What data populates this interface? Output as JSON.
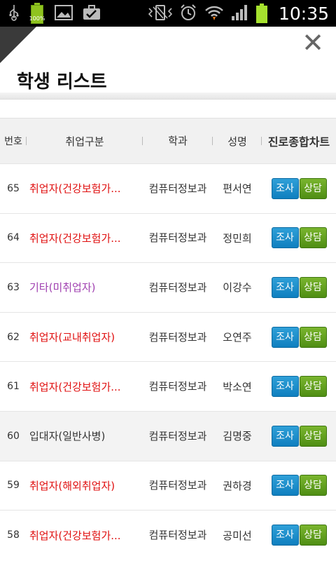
{
  "status_bar": {
    "time": "10:35",
    "battery_left_label": "100%",
    "icons": [
      "usb-icon",
      "battery-icon",
      "image-icon",
      "briefcase-icon",
      "vibrate-icon",
      "alarm-icon",
      "wifi-icon",
      "signal-icon",
      "battery-icon"
    ]
  },
  "header": {
    "title": "학생 리스트",
    "close_label": "✕"
  },
  "table": {
    "columns": [
      "번호",
      "취업구분",
      "학과",
      "성명",
      "진로종합차트"
    ],
    "survey_label": "조사",
    "consult_label": "상담",
    "rows": [
      {
        "num": "65",
        "type": "취업자(건강보험가...",
        "type_color": "red",
        "dept": "컴퓨터정보과",
        "name": "편서연"
      },
      {
        "num": "64",
        "type": "취업자(건강보험가...",
        "type_color": "red",
        "dept": "컴퓨터정보과",
        "name": "정민희"
      },
      {
        "num": "63",
        "type": "기타(미취업자)",
        "type_color": "purple",
        "dept": "컴퓨터정보과",
        "name": "이강수"
      },
      {
        "num": "62",
        "type": "취업자(교내취업자)",
        "type_color": "red",
        "dept": "컴퓨터정보과",
        "name": "오연주"
      },
      {
        "num": "61",
        "type": "취업자(건강보험가...",
        "type_color": "red",
        "dept": "컴퓨터정보과",
        "name": "박소연"
      },
      {
        "num": "60",
        "type": "입대자(일반사병)",
        "type_color": "gray",
        "dept": "컴퓨터정보과",
        "name": "김명중"
      },
      {
        "num": "59",
        "type": "취업자(해외취업자)",
        "type_color": "red",
        "dept": "컴퓨터정보과",
        "name": "권하경"
      },
      {
        "num": "58",
        "type": "취업자(건강보험가...",
        "type_color": "red",
        "dept": "컴퓨터정보과",
        "name": "공미선"
      }
    ]
  },
  "colors": {
    "red_text": "#e01010",
    "purple_text": "#a040b0",
    "survey_button": "#1a88c9",
    "consult_button": "#5f9e1e"
  }
}
